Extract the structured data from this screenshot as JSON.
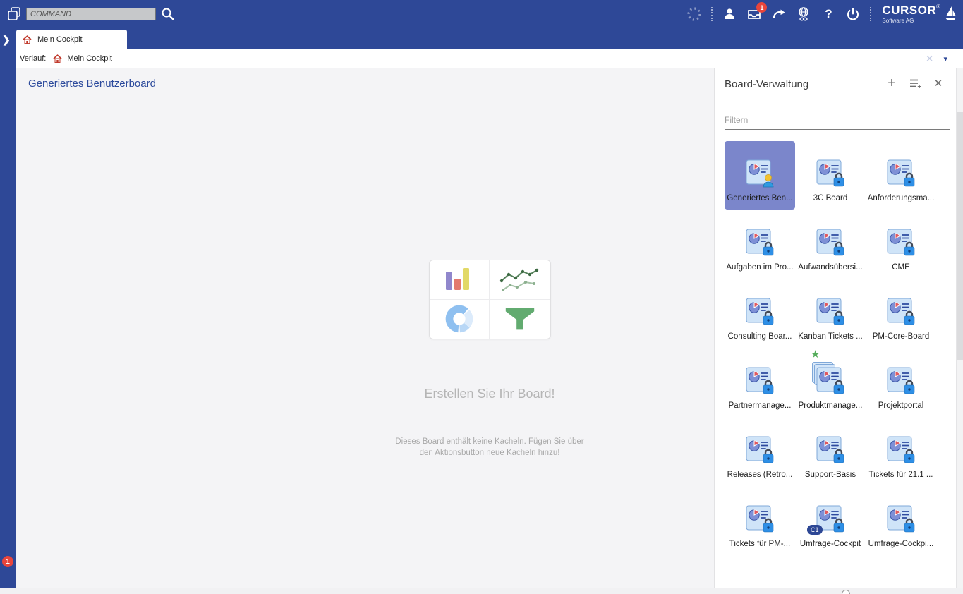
{
  "header": {
    "command_placeholder": "COMMAND",
    "notification_badge": "1",
    "help_glyph": "?",
    "logo_text": "CURSOR",
    "logo_registered": "®",
    "logo_subtitle": "Software AG"
  },
  "tab_bar": {
    "active_tab": "Mein Cockpit",
    "chevron_glyph": "❯"
  },
  "history_bar": {
    "label": "Verlauf:",
    "entry": "Mein Cockpit",
    "clear_glyph": "✕",
    "caret_glyph": "▾"
  },
  "sidebar": {
    "notification_badge": "1"
  },
  "main": {
    "board_title": "Generiertes Benutzerboard",
    "empty_heading": "Erstellen Sie Ihr Board!",
    "empty_description_line1": "Dieses Board enthält keine Kacheln. Fügen Sie über",
    "empty_description_line2": "den Aktionsbutton neue Kacheln hinzu!"
  },
  "board_panel": {
    "title": "Board-Verwaltung",
    "add_glyph": "+",
    "close_glyph": "✕",
    "filter_placeholder": "Filtern",
    "c1_badge": "C1",
    "star_glyph": "★",
    "tiles": [
      {
        "label": "Generiertes Ben...",
        "badge": "person",
        "selected": true
      },
      {
        "label": "3C Board",
        "badge": "lock"
      },
      {
        "label": "Anforderungsma...",
        "badge": "lock"
      },
      {
        "label": "Aufgaben im Pro...",
        "badge": "lock"
      },
      {
        "label": "Aufwandsübersi...",
        "badge": "lock"
      },
      {
        "label": "CME",
        "badge": "lock"
      },
      {
        "label": "Consulting Boar...",
        "badge": "lock"
      },
      {
        "label": "Kanban Tickets ...",
        "badge": "lock"
      },
      {
        "label": "PM-Core-Board",
        "badge": "lock"
      },
      {
        "label": "Partnermanage...",
        "badge": "lock"
      },
      {
        "label": "Produktmanage...",
        "badge": "lock",
        "star": true,
        "stacked": true
      },
      {
        "label": "Projektportal",
        "badge": "lock"
      },
      {
        "label": "Releases (Retro...",
        "badge": "lock"
      },
      {
        "label": "Support-Basis",
        "badge": "lock"
      },
      {
        "label": "Tickets für 21.1 ...",
        "badge": "lock"
      },
      {
        "label": "Tickets für PM-...",
        "badge": "lock"
      },
      {
        "label": "Umfrage-Cockpit",
        "badge": "lock",
        "c1": true
      },
      {
        "label": "Umfrage-Cockpi...",
        "badge": "lock"
      }
    ]
  },
  "colors": {
    "header_blue": "#2e4897",
    "selected_tile": "#7b86cb",
    "badge_red": "#e8453c",
    "tile_icon_bg": "#cfe4f8",
    "lock_blue": "#2e8fe6",
    "star_green": "#56ad5c",
    "title_blue": "#2c4a9c"
  }
}
